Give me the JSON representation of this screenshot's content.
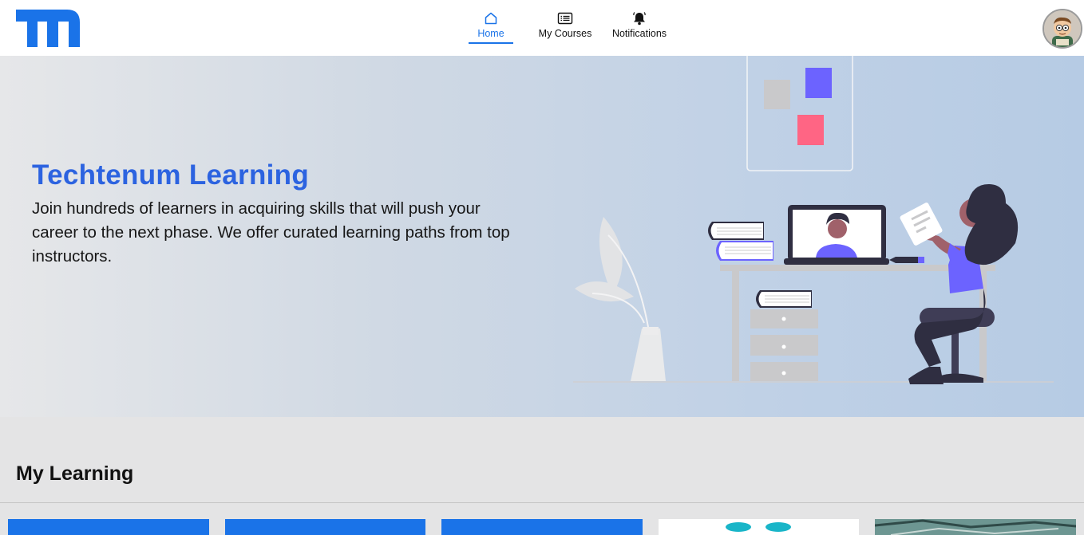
{
  "header": {
    "logo_alt": "m",
    "nav": [
      {
        "label": "Home",
        "icon": "home-icon",
        "active": true
      },
      {
        "label": "My Courses",
        "icon": "list-icon",
        "active": false
      },
      {
        "label": "Notifications",
        "icon": "bell-icon",
        "active": false
      }
    ],
    "avatar_icon": "user-avatar"
  },
  "hero": {
    "title": "Techtenum Learning",
    "description": "Join hundreds of learners in acquiring skills that will push your career to the next phase. We offer curated learning paths from top instructors."
  },
  "my_learning": {
    "title": "My Learning"
  },
  "colors": {
    "brand_blue": "#1a73e8",
    "title_blue": "#2c63e0",
    "accent_purple": "#6c63ff",
    "accent_pink": "#ff6584",
    "dark_navy": "#2f2e41"
  }
}
